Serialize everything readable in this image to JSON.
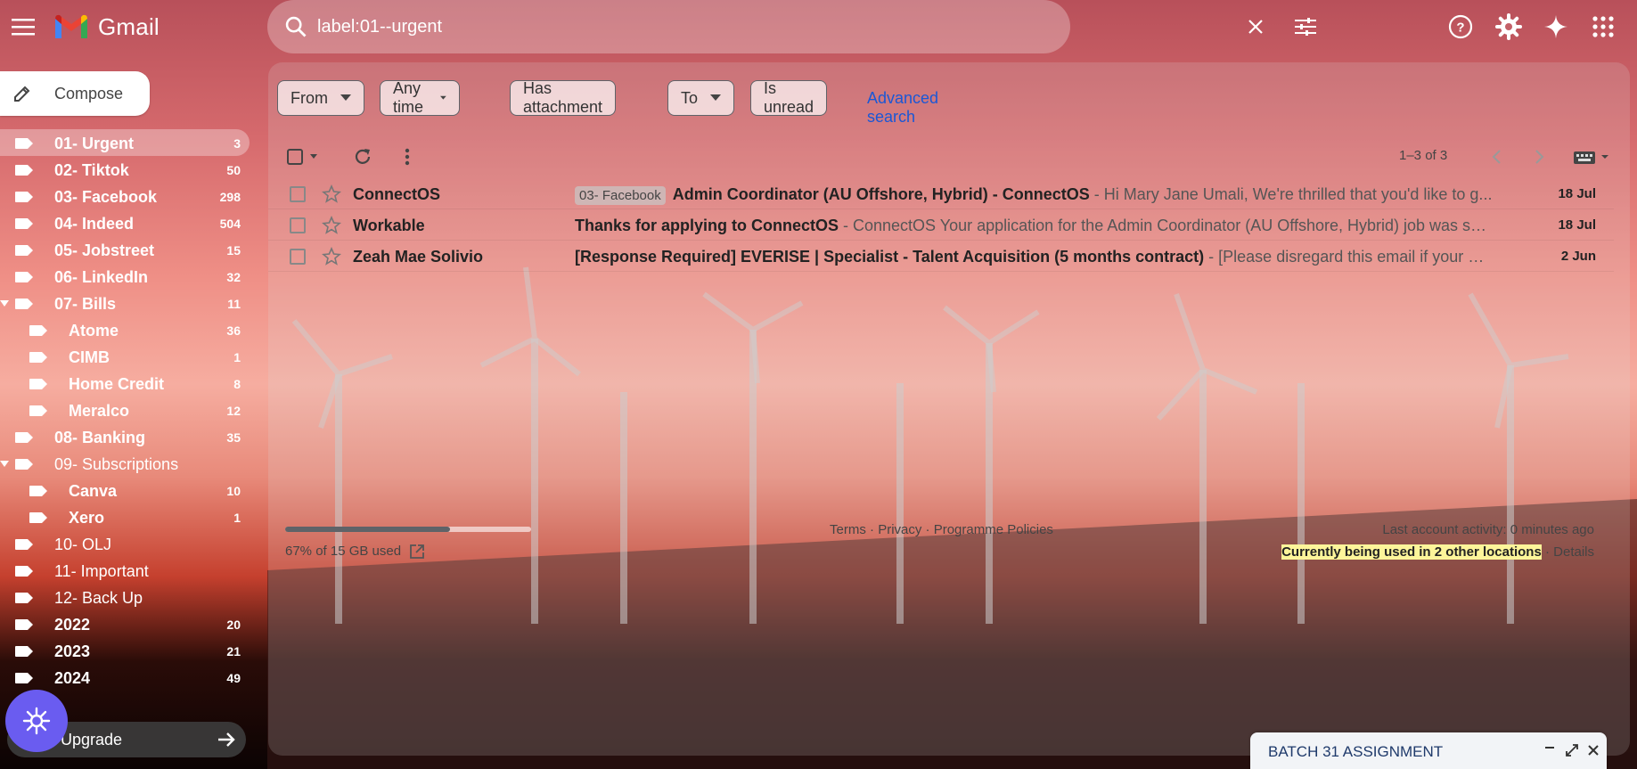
{
  "app": {
    "name": "Gmail",
    "brand_color_red": "#ea4335",
    "brand_color_blue": "#4285f4",
    "brand_color_green": "#34a853",
    "brand_color_yellow": "#fbbc04"
  },
  "search": {
    "value": "label:01--urgent",
    "clear_icon": "close-icon",
    "options_icon": "tune-icon"
  },
  "top_icons": [
    "help-icon",
    "settings-icon",
    "gemini-icon",
    "apps-icon"
  ],
  "compose": {
    "label": "Compose"
  },
  "sidebar": {
    "labels": [
      {
        "name": "01- Urgent",
        "count": "3",
        "active": true,
        "bold": true,
        "sub": false,
        "caret": false
      },
      {
        "name": "02- Tiktok",
        "count": "50",
        "active": false,
        "bold": true,
        "sub": false,
        "caret": false
      },
      {
        "name": "03- Facebook",
        "count": "298",
        "active": false,
        "bold": true,
        "sub": false,
        "caret": false
      },
      {
        "name": "04- Indeed",
        "count": "504",
        "active": false,
        "bold": true,
        "sub": false,
        "caret": false
      },
      {
        "name": "05- Jobstreet",
        "count": "15",
        "active": false,
        "bold": true,
        "sub": false,
        "caret": false
      },
      {
        "name": "06- LinkedIn",
        "count": "32",
        "active": false,
        "bold": true,
        "sub": false,
        "caret": false
      },
      {
        "name": "07- Bills",
        "count": "11",
        "active": false,
        "bold": true,
        "sub": false,
        "caret": true
      },
      {
        "name": "Atome",
        "count": "36",
        "active": false,
        "bold": true,
        "sub": true,
        "caret": false
      },
      {
        "name": "CIMB",
        "count": "1",
        "active": false,
        "bold": true,
        "sub": true,
        "caret": false
      },
      {
        "name": "Home Credit",
        "count": "8",
        "active": false,
        "bold": true,
        "sub": true,
        "caret": false
      },
      {
        "name": "Meralco",
        "count": "12",
        "active": false,
        "bold": true,
        "sub": true,
        "caret": false
      },
      {
        "name": "08- Banking",
        "count": "35",
        "active": false,
        "bold": true,
        "sub": false,
        "caret": false
      },
      {
        "name": "09- Subscriptions",
        "count": "",
        "active": false,
        "bold": false,
        "sub": false,
        "caret": true
      },
      {
        "name": "Canva",
        "count": "10",
        "active": false,
        "bold": true,
        "sub": true,
        "caret": false
      },
      {
        "name": "Xero",
        "count": "1",
        "active": false,
        "bold": true,
        "sub": true,
        "caret": false
      },
      {
        "name": "10- OLJ",
        "count": "",
        "active": false,
        "bold": false,
        "sub": false,
        "caret": false
      },
      {
        "name": "11- Important",
        "count": "",
        "active": false,
        "bold": false,
        "sub": false,
        "caret": false
      },
      {
        "name": "12- Back Up",
        "count": "",
        "active": false,
        "bold": false,
        "sub": false,
        "caret": false
      },
      {
        "name": "2022",
        "count": "20",
        "active": false,
        "bold": true,
        "sub": false,
        "caret": false
      },
      {
        "name": "2023",
        "count": "21",
        "active": false,
        "bold": true,
        "sub": false,
        "caret": false
      },
      {
        "name": "2024",
        "count": "49",
        "active": false,
        "bold": true,
        "sub": false,
        "caret": false
      }
    ],
    "upgrade_label": "Upgrade"
  },
  "filters": {
    "chips": [
      {
        "label": "From",
        "dropdown": true
      },
      {
        "label": "Any time",
        "dropdown": true
      },
      {
        "label": "Has attachment",
        "dropdown": false
      },
      {
        "label": "To",
        "dropdown": true
      },
      {
        "label": "Is unread",
        "dropdown": false
      }
    ],
    "advanced_search": "Advanced search"
  },
  "toolbar": {
    "page_info": "1–3 of 3"
  },
  "emails": [
    {
      "sender": "ConnectOS",
      "label_chip": "03- Facebook",
      "subject": "Admin Coordinator (AU Offshore, Hybrid) - ConnectOS",
      "snippet": " - Hi Mary Jane Umali, We're thrilled that you'd like to g...",
      "date": "18 Jul"
    },
    {
      "sender": "Workable",
      "label_chip": "",
      "subject": "Thanks for applying to ConnectOS",
      "snippet": " - ConnectOS Your application for the Admin Coordinator (AU Offshore, Hybrid) job was su...",
      "date": "18 Jul"
    },
    {
      "sender": "Zeah Mae Solivio",
      "label_chip": "",
      "subject": "[Response Required] EVERISE | Specialist - Talent Acquisition (5 months contract)",
      "snippet": " - [Please disregard this email if your ap...",
      "date": "2 Jun"
    }
  ],
  "footer": {
    "storage_used_fraction": 0.67,
    "storage_text": "67% of 15 GB used",
    "links": [
      "Terms",
      "Privacy",
      "Programme Policies"
    ],
    "last_activity": "Last account activity: 0 minutes ago",
    "locations_highlight": "Currently being used in 2 other locations",
    "details": "Details"
  },
  "minimized_compose": {
    "title": "BATCH 31 ASSIGNMENT"
  }
}
